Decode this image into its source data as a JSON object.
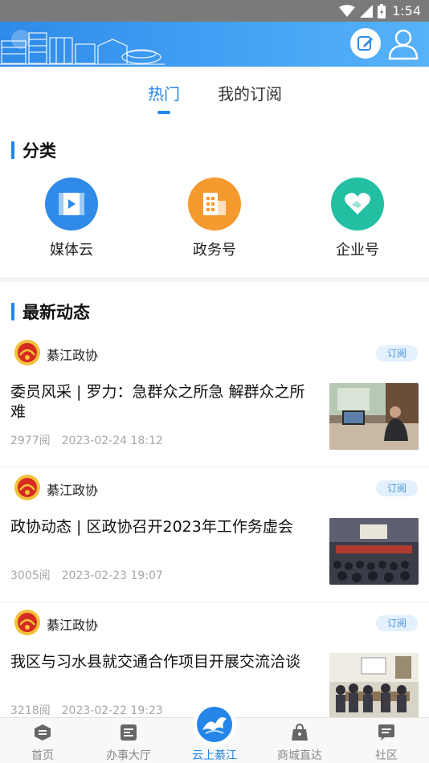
{
  "status_bar": {
    "time": "1:54"
  },
  "tabs": [
    {
      "label": "热门"
    },
    {
      "label": "我的订阅"
    }
  ],
  "categories_section": {
    "title": "分类",
    "items": [
      {
        "label": "媒体云",
        "icon": "video-icon",
        "color": "#2f8ae8"
      },
      {
        "label": "政务号",
        "icon": "building-icon",
        "color": "#f59a2f"
      },
      {
        "label": "企业号",
        "icon": "heart-handshake-icon",
        "color": "#23bfa3"
      }
    ]
  },
  "news_section": {
    "title": "最新动态",
    "items": [
      {
        "source": "綦江政协",
        "subscribe": "订阅",
        "title": "委员风采 | 罗力：急群众之所急 解群众之所难",
        "views": "2977阅",
        "time": "2023-02-24 18:12"
      },
      {
        "source": "綦江政协",
        "subscribe": "订阅",
        "title": "政协动态 | 区政协召开2023年工作务虚会",
        "views": "3005阅",
        "time": "2023-02-23 19:07"
      },
      {
        "source": "綦江政协",
        "subscribe": "订阅",
        "title": "我区与习水县就交通合作项目开展交流洽谈",
        "views": "3218阅",
        "time": "2023-02-22 19:23"
      }
    ]
  },
  "bottom_nav": [
    {
      "label": "首页",
      "icon": "home-icon"
    },
    {
      "label": "办事大厅",
      "icon": "service-hall-icon"
    },
    {
      "label": "云上綦江",
      "icon": "app-logo-icon"
    },
    {
      "label": "商城直达",
      "icon": "shopping-bag-icon"
    },
    {
      "label": "社区",
      "icon": "community-icon"
    }
  ],
  "colors": {
    "accent": "#2486e8",
    "header": "#3a96ee"
  }
}
